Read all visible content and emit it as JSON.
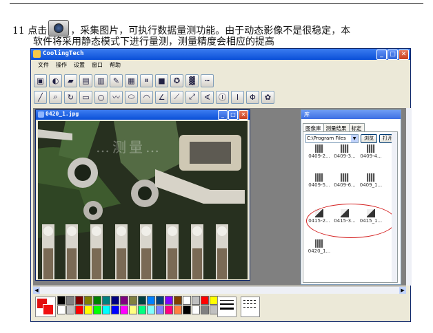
{
  "instruction": {
    "step_number": "11",
    "line1_before_icon": "点击",
    "line1_after_icon": "，采集图片，可执行数据量测功能。由于动态影像不是很稳定，本",
    "line2": "软件将采用静态模式下进行量测，测量精度会相应的提高"
  },
  "app": {
    "title": "CoolingTech",
    "window_buttons": [
      "_",
      "□",
      "✕"
    ],
    "menu": [
      "文件",
      "操作",
      "设置",
      "窗口",
      "帮助"
    ]
  },
  "toolbar1": [
    {
      "name": "capture-camera-icon",
      "glyph": "▣"
    },
    {
      "name": "magnify-icon",
      "glyph": "◐"
    },
    {
      "name": "open-folder-icon",
      "glyph": "▰"
    },
    {
      "name": "image-icon",
      "glyph": "▤"
    },
    {
      "name": "image-alt-icon",
      "glyph": "▥"
    },
    {
      "name": "settings-icon",
      "glyph": "✎"
    },
    {
      "name": "save-disk-icon",
      "glyph": "▦"
    },
    {
      "name": "pause-icon",
      "glyph": "⏸"
    },
    {
      "name": "stop-icon",
      "glyph": "■"
    },
    {
      "name": "tool-icon",
      "glyph": "✪"
    },
    {
      "name": "grid-icon",
      "glyph": "▓"
    },
    {
      "name": "ruler-icon",
      "glyph": "┅"
    }
  ],
  "toolbar2": [
    {
      "name": "line-tool-icon",
      "glyph": "╱"
    },
    {
      "name": "zoom-tool-icon",
      "glyph": "⌕"
    },
    {
      "name": "rotate-tool-icon",
      "glyph": "↻"
    },
    {
      "name": "rectangle-tool-icon",
      "glyph": "▭"
    },
    {
      "name": "circle-tool-icon",
      "glyph": "○"
    },
    {
      "name": "freehand-tool-icon",
      "glyph": "〰"
    },
    {
      "name": "ellipse-tool-icon",
      "glyph": "⬭"
    },
    {
      "name": "arc-tool-icon",
      "glyph": "◠"
    },
    {
      "name": "angle-tool-icon",
      "glyph": "∠"
    },
    {
      "name": "polyline-tool-icon",
      "glyph": "⟋"
    },
    {
      "name": "diagonal-tool-icon",
      "glyph": "⤢"
    },
    {
      "name": "angle-measure-icon",
      "glyph": "∢"
    },
    {
      "name": "vertical-measure-icon",
      "glyph": "Ⓘ"
    },
    {
      "name": "height-measure-icon",
      "glyph": "Ⅰ"
    },
    {
      "name": "diameter-icon",
      "glyph": "Φ"
    },
    {
      "name": "palette-icon",
      "glyph": "✿"
    }
  ],
  "image_window": {
    "title": "0420_1.jpg",
    "watermark": "…测量…"
  },
  "library": {
    "title": "库",
    "tabs": [
      "图像库",
      "测量结果",
      "标定"
    ],
    "path": "C:\\Program Files",
    "browse_label": "浏览",
    "open_label": "打开",
    "thumbnails": [
      "0409-2...",
      "0409-3...",
      "0409-4...",
      "0409-5...",
      "0409-6...",
      "0409_1...",
      "0415-2...",
      "0415-3...",
      "0415_1...",
      "0420_1..."
    ]
  },
  "palette": {
    "current_fg": "#e01010",
    "current_bg": "#f01010",
    "colors": [
      "#000000",
      "#808080",
      "#800000",
      "#808000",
      "#008000",
      "#008080",
      "#000080",
      "#800080",
      "#808040",
      "#004040",
      "#0080ff",
      "#004080",
      "#8000ff",
      "#804000",
      "#ffffff",
      "#c0c0c0",
      "#ff0000",
      "#ffff00",
      "#ffffff",
      "#c0c0c0",
      "#ff0000",
      "#ffff00",
      "#00ff00",
      "#00ffff",
      "#0000ff",
      "#ff00ff",
      "#ffff80",
      "#00ff80",
      "#80ffff",
      "#8080ff",
      "#ff0080",
      "#ff8040",
      "#000000",
      "#ffffff",
      "#808080",
      "#c0c0c0"
    ]
  }
}
